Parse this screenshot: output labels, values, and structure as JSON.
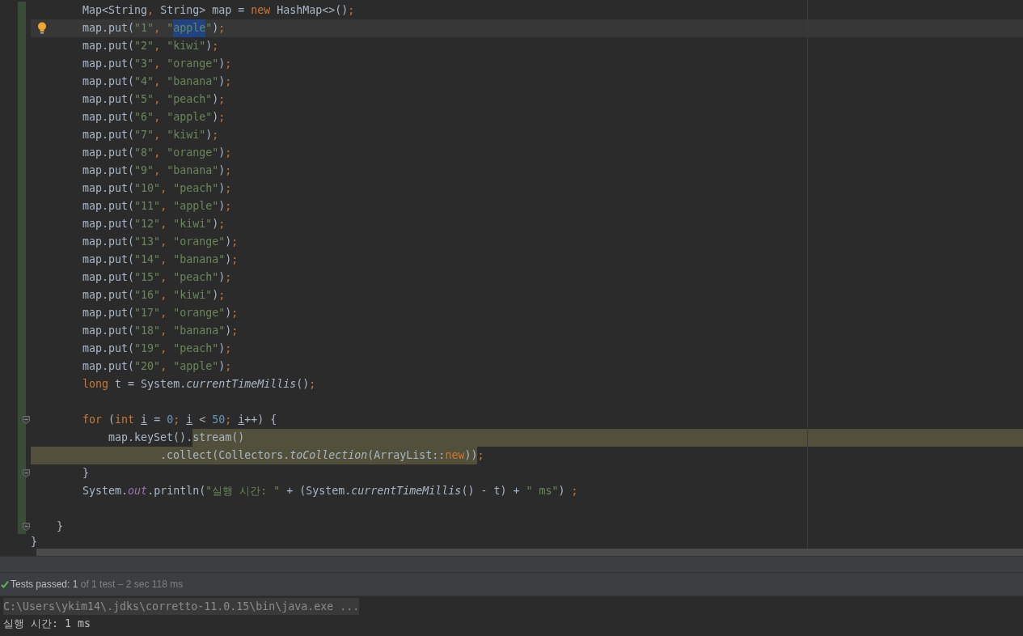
{
  "editor": {
    "lines": [
      {
        "current": false,
        "fill_to_end": false,
        "bulb": false,
        "fold_marker": false,
        "tokens": [
          {
            "text": "        Map<String",
            "kind": "plain"
          },
          {
            "text": ",",
            "kind": "punct"
          },
          {
            "text": " String> map = ",
            "kind": "plain"
          },
          {
            "text": "new",
            "kind": "keyword"
          },
          {
            "text": " HashMap<>()",
            "kind": "plain"
          },
          {
            "text": ";",
            "kind": "punct"
          }
        ]
      },
      {
        "current": true,
        "fill_to_end": false,
        "bulb": true,
        "fold_marker": false,
        "tokens": [
          {
            "text": "        map.put(",
            "kind": "plain",
            "selected": false
          },
          {
            "text": "\"1\"",
            "kind": "string",
            "selected": false
          },
          {
            "text": ",",
            "kind": "punct",
            "selected": false
          },
          {
            "text": " \"",
            "kind": "string",
            "selected": false
          },
          {
            "text": "apple",
            "kind": "string",
            "selected": true
          },
          {
            "text": "\"",
            "kind": "string",
            "selected": false
          },
          {
            "text": ")",
            "kind": "plain",
            "selected": false
          },
          {
            "text": ";",
            "kind": "punct",
            "selected": false
          }
        ]
      },
      {
        "current": false,
        "fill_to_end": false,
        "bulb": false,
        "fold_marker": false,
        "tokens": [
          {
            "text": "        map.put(",
            "kind": "plain"
          },
          {
            "text": "\"2\"",
            "kind": "string"
          },
          {
            "text": ",",
            "kind": "punct"
          },
          {
            "text": " \"kiwi\"",
            "kind": "string"
          },
          {
            "text": ")",
            "kind": "plain"
          },
          {
            "text": ";",
            "kind": "punct"
          }
        ]
      },
      {
        "current": false,
        "fill_to_end": false,
        "bulb": false,
        "fold_marker": false,
        "tokens": [
          {
            "text": "        map.put(",
            "kind": "plain"
          },
          {
            "text": "\"3\"",
            "kind": "string"
          },
          {
            "text": ",",
            "kind": "punct"
          },
          {
            "text": " \"orange\"",
            "kind": "string"
          },
          {
            "text": ")",
            "kind": "plain"
          },
          {
            "text": ";",
            "kind": "punct"
          }
        ]
      },
      {
        "current": false,
        "fill_to_end": false,
        "bulb": false,
        "fold_marker": false,
        "tokens": [
          {
            "text": "        map.put(",
            "kind": "plain"
          },
          {
            "text": "\"4\"",
            "kind": "string"
          },
          {
            "text": ",",
            "kind": "punct"
          },
          {
            "text": " \"banana\"",
            "kind": "string"
          },
          {
            "text": ")",
            "kind": "plain"
          },
          {
            "text": ";",
            "kind": "punct"
          }
        ]
      },
      {
        "current": false,
        "fill_to_end": false,
        "bulb": false,
        "fold_marker": false,
        "tokens": [
          {
            "text": "        map.put(",
            "kind": "plain"
          },
          {
            "text": "\"5\"",
            "kind": "string"
          },
          {
            "text": ",",
            "kind": "punct"
          },
          {
            "text": " \"peach\"",
            "kind": "string"
          },
          {
            "text": ")",
            "kind": "plain"
          },
          {
            "text": ";",
            "kind": "punct"
          }
        ]
      },
      {
        "current": false,
        "fill_to_end": false,
        "bulb": false,
        "fold_marker": false,
        "tokens": [
          {
            "text": "        map.put(",
            "kind": "plain"
          },
          {
            "text": "\"6\"",
            "kind": "string"
          },
          {
            "text": ",",
            "kind": "punct"
          },
          {
            "text": " \"apple\"",
            "kind": "string"
          },
          {
            "text": ")",
            "kind": "plain"
          },
          {
            "text": ";",
            "kind": "punct"
          }
        ]
      },
      {
        "current": false,
        "fill_to_end": false,
        "bulb": false,
        "fold_marker": false,
        "tokens": [
          {
            "text": "        map.put(",
            "kind": "plain"
          },
          {
            "text": "\"7\"",
            "kind": "string"
          },
          {
            "text": ",",
            "kind": "punct"
          },
          {
            "text": " \"kiwi\"",
            "kind": "string"
          },
          {
            "text": ")",
            "kind": "plain"
          },
          {
            "text": ";",
            "kind": "punct"
          }
        ]
      },
      {
        "current": false,
        "fill_to_end": false,
        "bulb": false,
        "fold_marker": false,
        "tokens": [
          {
            "text": "        map.put(",
            "kind": "plain"
          },
          {
            "text": "\"8\"",
            "kind": "string"
          },
          {
            "text": ",",
            "kind": "punct"
          },
          {
            "text": " \"orange\"",
            "kind": "string"
          },
          {
            "text": ")",
            "kind": "plain"
          },
          {
            "text": ";",
            "kind": "punct"
          }
        ]
      },
      {
        "current": false,
        "fill_to_end": false,
        "bulb": false,
        "fold_marker": false,
        "tokens": [
          {
            "text": "        map.put(",
            "kind": "plain"
          },
          {
            "text": "\"9\"",
            "kind": "string"
          },
          {
            "text": ",",
            "kind": "punct"
          },
          {
            "text": " \"banana\"",
            "kind": "string"
          },
          {
            "text": ")",
            "kind": "plain"
          },
          {
            "text": ";",
            "kind": "punct"
          }
        ]
      },
      {
        "current": false,
        "fill_to_end": false,
        "bulb": false,
        "fold_marker": false,
        "tokens": [
          {
            "text": "        map.put(",
            "kind": "plain"
          },
          {
            "text": "\"10\"",
            "kind": "string"
          },
          {
            "text": ",",
            "kind": "punct"
          },
          {
            "text": " \"peach\"",
            "kind": "string"
          },
          {
            "text": ")",
            "kind": "plain"
          },
          {
            "text": ";",
            "kind": "punct"
          }
        ]
      },
      {
        "current": false,
        "fill_to_end": false,
        "bulb": false,
        "fold_marker": false,
        "tokens": [
          {
            "text": "        map.put(",
            "kind": "plain"
          },
          {
            "text": "\"11\"",
            "kind": "string"
          },
          {
            "text": ",",
            "kind": "punct"
          },
          {
            "text": " \"apple\"",
            "kind": "string"
          },
          {
            "text": ")",
            "kind": "plain"
          },
          {
            "text": ";",
            "kind": "punct"
          }
        ]
      },
      {
        "current": false,
        "fill_to_end": false,
        "bulb": false,
        "fold_marker": false,
        "tokens": [
          {
            "text": "        map.put(",
            "kind": "plain"
          },
          {
            "text": "\"12\"",
            "kind": "string"
          },
          {
            "text": ",",
            "kind": "punct"
          },
          {
            "text": " \"kiwi\"",
            "kind": "string"
          },
          {
            "text": ")",
            "kind": "plain"
          },
          {
            "text": ";",
            "kind": "punct"
          }
        ]
      },
      {
        "current": false,
        "fill_to_end": false,
        "bulb": false,
        "fold_marker": false,
        "tokens": [
          {
            "text": "        map.put(",
            "kind": "plain"
          },
          {
            "text": "\"13\"",
            "kind": "string"
          },
          {
            "text": ",",
            "kind": "punct"
          },
          {
            "text": " \"orange\"",
            "kind": "string"
          },
          {
            "text": ")",
            "kind": "plain"
          },
          {
            "text": ";",
            "kind": "punct"
          }
        ]
      },
      {
        "current": false,
        "fill_to_end": false,
        "bulb": false,
        "fold_marker": false,
        "tokens": [
          {
            "text": "        map.put(",
            "kind": "plain"
          },
          {
            "text": "\"14\"",
            "kind": "string"
          },
          {
            "text": ",",
            "kind": "punct"
          },
          {
            "text": " \"banana\"",
            "kind": "string"
          },
          {
            "text": ")",
            "kind": "plain"
          },
          {
            "text": ";",
            "kind": "punct"
          }
        ]
      },
      {
        "current": false,
        "fill_to_end": false,
        "bulb": false,
        "fold_marker": false,
        "tokens": [
          {
            "text": "        map.put(",
            "kind": "plain"
          },
          {
            "text": "\"15\"",
            "kind": "string"
          },
          {
            "text": ",",
            "kind": "punct"
          },
          {
            "text": " \"peach\"",
            "kind": "string"
          },
          {
            "text": ")",
            "kind": "plain"
          },
          {
            "text": ";",
            "kind": "punct"
          }
        ]
      },
      {
        "current": false,
        "fill_to_end": false,
        "bulb": false,
        "fold_marker": false,
        "tokens": [
          {
            "text": "        map.put(",
            "kind": "plain"
          },
          {
            "text": "\"16\"",
            "kind": "string"
          },
          {
            "text": ",",
            "kind": "punct"
          },
          {
            "text": " \"kiwi\"",
            "kind": "string"
          },
          {
            "text": ")",
            "kind": "plain"
          },
          {
            "text": ";",
            "kind": "punct"
          }
        ]
      },
      {
        "current": false,
        "fill_to_end": false,
        "bulb": false,
        "fold_marker": false,
        "tokens": [
          {
            "text": "        map.put(",
            "kind": "plain"
          },
          {
            "text": "\"17\"",
            "kind": "string"
          },
          {
            "text": ",",
            "kind": "punct"
          },
          {
            "text": " \"orange\"",
            "kind": "string"
          },
          {
            "text": ")",
            "kind": "plain"
          },
          {
            "text": ";",
            "kind": "punct"
          }
        ]
      },
      {
        "current": false,
        "fill_to_end": false,
        "bulb": false,
        "fold_marker": false,
        "tokens": [
          {
            "text": "        map.put(",
            "kind": "plain"
          },
          {
            "text": "\"18\"",
            "kind": "string"
          },
          {
            "text": ",",
            "kind": "punct"
          },
          {
            "text": " \"banana\"",
            "kind": "string"
          },
          {
            "text": ")",
            "kind": "plain"
          },
          {
            "text": ";",
            "kind": "punct"
          }
        ]
      },
      {
        "current": false,
        "fill_to_end": false,
        "bulb": false,
        "fold_marker": false,
        "tokens": [
          {
            "text": "        map.put(",
            "kind": "plain"
          },
          {
            "text": "\"19\"",
            "kind": "string"
          },
          {
            "text": ",",
            "kind": "punct"
          },
          {
            "text": " \"peach\"",
            "kind": "string"
          },
          {
            "text": ")",
            "kind": "plain"
          },
          {
            "text": ";",
            "kind": "punct"
          }
        ]
      },
      {
        "current": false,
        "fill_to_end": false,
        "bulb": false,
        "fold_marker": false,
        "tokens": [
          {
            "text": "        map.put(",
            "kind": "plain"
          },
          {
            "text": "\"20\"",
            "kind": "string"
          },
          {
            "text": ",",
            "kind": "punct"
          },
          {
            "text": " \"apple\"",
            "kind": "string"
          },
          {
            "text": ")",
            "kind": "plain"
          },
          {
            "text": ";",
            "kind": "punct"
          }
        ]
      },
      {
        "current": false,
        "fill_to_end": false,
        "bulb": false,
        "fold_marker": false,
        "tokens": [
          {
            "text": "        long",
            "kind": "keyword"
          },
          {
            "text": " t = System.",
            "kind": "plain"
          },
          {
            "text": "currentTimeMillis",
            "kind": "method"
          },
          {
            "text": "()",
            "kind": "plain"
          },
          {
            "text": ";",
            "kind": "punct"
          }
        ]
      },
      {
        "current": false,
        "fill_to_end": false,
        "bulb": false,
        "fold_marker": false
      },
      {
        "current": false,
        "fill_to_end": false,
        "bulb": false,
        "fold_marker": true,
        "tokens": [
          {
            "text": "        for",
            "kind": "keyword"
          },
          {
            "text": " (",
            "kind": "plain"
          },
          {
            "text": "int ",
            "kind": "keyword"
          },
          {
            "text": "i",
            "kind": "local"
          },
          {
            "text": " = ",
            "kind": "plain"
          },
          {
            "text": "0",
            "kind": "number"
          },
          {
            "text": "; ",
            "kind": "punct"
          },
          {
            "text": "i",
            "kind": "local"
          },
          {
            "text": " < ",
            "kind": "plain"
          },
          {
            "text": "50",
            "kind": "number"
          },
          {
            "text": "; ",
            "kind": "punct"
          },
          {
            "text": "i",
            "kind": "local"
          },
          {
            "text": "++) {",
            "kind": "plain"
          }
        ]
      },
      {
        "current": false,
        "fill_to_end": true,
        "bulb": false,
        "fold_marker": false,
        "tokens": [
          {
            "text": "            map.keySet().",
            "kind": "plain",
            "highlighted": false
          },
          {
            "text": "stream()",
            "kind": "plain",
            "highlighted": true
          }
        ]
      },
      {
        "current": false,
        "fill_to_end": false,
        "bulb": false,
        "fold_marker": false,
        "tokens": [
          {
            "text": "                    .collect(Collectors.",
            "kind": "plain",
            "highlighted": true
          },
          {
            "text": "toCollection",
            "kind": "method",
            "highlighted": true
          },
          {
            "text": "(ArrayList::",
            "kind": "plain",
            "highlighted": true
          },
          {
            "text": "new",
            "kind": "keyword",
            "highlighted": true
          },
          {
            "text": "))",
            "kind": "plain",
            "highlighted": true
          },
          {
            "text": ";",
            "kind": "punct",
            "highlighted": false
          }
        ]
      },
      {
        "current": false,
        "fill_to_end": false,
        "bulb": false,
        "fold_marker": true,
        "tokens": [
          {
            "text": "        }",
            "kind": "plain"
          }
        ]
      },
      {
        "current": false,
        "fill_to_end": false,
        "bulb": false,
        "fold_marker": false,
        "tokens": [
          {
            "text": "        System.",
            "kind": "plain"
          },
          {
            "text": "out",
            "kind": "field"
          },
          {
            "text": ".println(",
            "kind": "plain"
          },
          {
            "text": "\"실행 시간: \"",
            "kind": "string"
          },
          {
            "text": " + (System.",
            "kind": "plain"
          },
          {
            "text": "currentTimeMillis",
            "kind": "method"
          },
          {
            "text": "() - t) + ",
            "kind": "plain"
          },
          {
            "text": "\" ms\"",
            "kind": "string"
          },
          {
            "text": ") ",
            "kind": "plain"
          },
          {
            "text": ";",
            "kind": "punct"
          }
        ]
      },
      {
        "current": false,
        "fill_to_end": false,
        "bulb": false,
        "fold_marker": false
      },
      {
        "current": false,
        "fill_to_end": false,
        "bulb": false,
        "fold_marker": true,
        "tokens": [
          {
            "text": "    }",
            "kind": "plain"
          }
        ]
      },
      {
        "current": false,
        "fill_to_end": false,
        "bulb": false,
        "fold_marker": false,
        "tokens": [
          {
            "text": "}",
            "kind": "plain"
          }
        ]
      }
    ]
  },
  "test_status": {
    "passed": true,
    "label": "Tests passed: 1",
    "detail": " of 1 test – 2 sec 118 ms"
  },
  "console": {
    "command": "C:\\Users\\ykim14\\.jdks\\corretto-11.0.15\\bin\\java.exe ...",
    "output": [
      "실행 시간: 1 ms"
    ]
  }
}
